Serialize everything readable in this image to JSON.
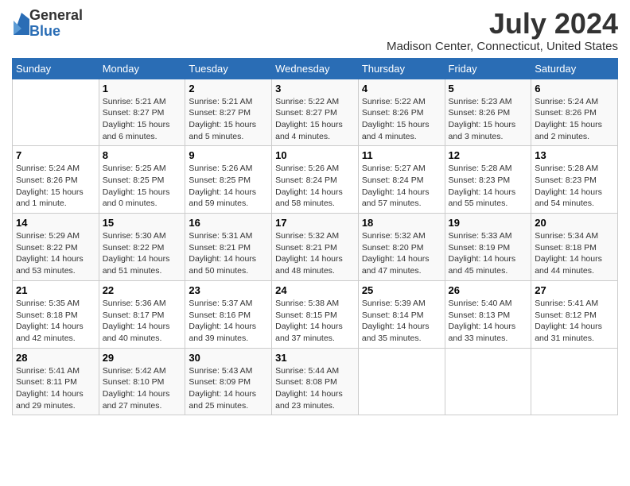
{
  "logo": {
    "general": "General",
    "blue": "Blue"
  },
  "title": "July 2024",
  "subtitle": "Madison Center, Connecticut, United States",
  "days_of_week": [
    "Sunday",
    "Monday",
    "Tuesday",
    "Wednesday",
    "Thursday",
    "Friday",
    "Saturday"
  ],
  "weeks": [
    [
      {
        "day": "",
        "info": ""
      },
      {
        "day": "1",
        "info": "Sunrise: 5:21 AM\nSunset: 8:27 PM\nDaylight: 15 hours\nand 6 minutes."
      },
      {
        "day": "2",
        "info": "Sunrise: 5:21 AM\nSunset: 8:27 PM\nDaylight: 15 hours\nand 5 minutes."
      },
      {
        "day": "3",
        "info": "Sunrise: 5:22 AM\nSunset: 8:27 PM\nDaylight: 15 hours\nand 4 minutes."
      },
      {
        "day": "4",
        "info": "Sunrise: 5:22 AM\nSunset: 8:26 PM\nDaylight: 15 hours\nand 4 minutes."
      },
      {
        "day": "5",
        "info": "Sunrise: 5:23 AM\nSunset: 8:26 PM\nDaylight: 15 hours\nand 3 minutes."
      },
      {
        "day": "6",
        "info": "Sunrise: 5:24 AM\nSunset: 8:26 PM\nDaylight: 15 hours\nand 2 minutes."
      }
    ],
    [
      {
        "day": "7",
        "info": "Sunrise: 5:24 AM\nSunset: 8:26 PM\nDaylight: 15 hours\nand 1 minute."
      },
      {
        "day": "8",
        "info": "Sunrise: 5:25 AM\nSunset: 8:25 PM\nDaylight: 15 hours\nand 0 minutes."
      },
      {
        "day": "9",
        "info": "Sunrise: 5:26 AM\nSunset: 8:25 PM\nDaylight: 14 hours\nand 59 minutes."
      },
      {
        "day": "10",
        "info": "Sunrise: 5:26 AM\nSunset: 8:24 PM\nDaylight: 14 hours\nand 58 minutes."
      },
      {
        "day": "11",
        "info": "Sunrise: 5:27 AM\nSunset: 8:24 PM\nDaylight: 14 hours\nand 57 minutes."
      },
      {
        "day": "12",
        "info": "Sunrise: 5:28 AM\nSunset: 8:23 PM\nDaylight: 14 hours\nand 55 minutes."
      },
      {
        "day": "13",
        "info": "Sunrise: 5:28 AM\nSunset: 8:23 PM\nDaylight: 14 hours\nand 54 minutes."
      }
    ],
    [
      {
        "day": "14",
        "info": "Sunrise: 5:29 AM\nSunset: 8:22 PM\nDaylight: 14 hours\nand 53 minutes."
      },
      {
        "day": "15",
        "info": "Sunrise: 5:30 AM\nSunset: 8:22 PM\nDaylight: 14 hours\nand 51 minutes."
      },
      {
        "day": "16",
        "info": "Sunrise: 5:31 AM\nSunset: 8:21 PM\nDaylight: 14 hours\nand 50 minutes."
      },
      {
        "day": "17",
        "info": "Sunrise: 5:32 AM\nSunset: 8:21 PM\nDaylight: 14 hours\nand 48 minutes."
      },
      {
        "day": "18",
        "info": "Sunrise: 5:32 AM\nSunset: 8:20 PM\nDaylight: 14 hours\nand 47 minutes."
      },
      {
        "day": "19",
        "info": "Sunrise: 5:33 AM\nSunset: 8:19 PM\nDaylight: 14 hours\nand 45 minutes."
      },
      {
        "day": "20",
        "info": "Sunrise: 5:34 AM\nSunset: 8:18 PM\nDaylight: 14 hours\nand 44 minutes."
      }
    ],
    [
      {
        "day": "21",
        "info": "Sunrise: 5:35 AM\nSunset: 8:18 PM\nDaylight: 14 hours\nand 42 minutes."
      },
      {
        "day": "22",
        "info": "Sunrise: 5:36 AM\nSunset: 8:17 PM\nDaylight: 14 hours\nand 40 minutes."
      },
      {
        "day": "23",
        "info": "Sunrise: 5:37 AM\nSunset: 8:16 PM\nDaylight: 14 hours\nand 39 minutes."
      },
      {
        "day": "24",
        "info": "Sunrise: 5:38 AM\nSunset: 8:15 PM\nDaylight: 14 hours\nand 37 minutes."
      },
      {
        "day": "25",
        "info": "Sunrise: 5:39 AM\nSunset: 8:14 PM\nDaylight: 14 hours\nand 35 minutes."
      },
      {
        "day": "26",
        "info": "Sunrise: 5:40 AM\nSunset: 8:13 PM\nDaylight: 14 hours\nand 33 minutes."
      },
      {
        "day": "27",
        "info": "Sunrise: 5:41 AM\nSunset: 8:12 PM\nDaylight: 14 hours\nand 31 minutes."
      }
    ],
    [
      {
        "day": "28",
        "info": "Sunrise: 5:41 AM\nSunset: 8:11 PM\nDaylight: 14 hours\nand 29 minutes."
      },
      {
        "day": "29",
        "info": "Sunrise: 5:42 AM\nSunset: 8:10 PM\nDaylight: 14 hours\nand 27 minutes."
      },
      {
        "day": "30",
        "info": "Sunrise: 5:43 AM\nSunset: 8:09 PM\nDaylight: 14 hours\nand 25 minutes."
      },
      {
        "day": "31",
        "info": "Sunrise: 5:44 AM\nSunset: 8:08 PM\nDaylight: 14 hours\nand 23 minutes."
      },
      {
        "day": "",
        "info": ""
      },
      {
        "day": "",
        "info": ""
      },
      {
        "day": "",
        "info": ""
      }
    ]
  ]
}
